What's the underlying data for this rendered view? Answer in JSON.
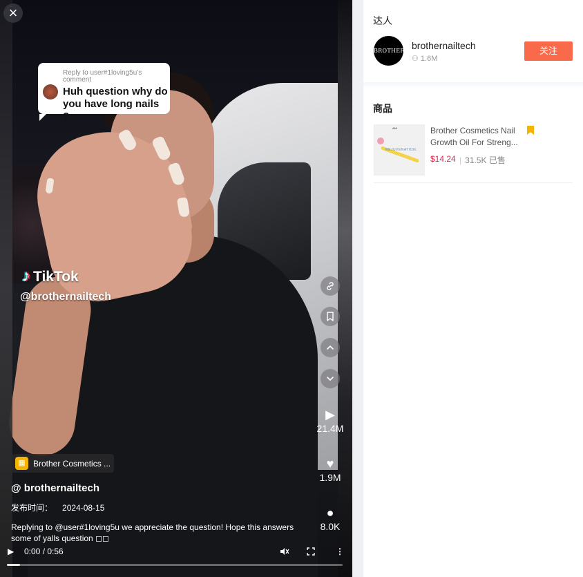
{
  "video": {
    "close_icon": "×",
    "comment_bubble": {
      "reply_to": "Reply to user#1loving5u's comment",
      "question": "Huh question why do you have long nails ?"
    },
    "watermark": {
      "brand": "TikTok",
      "handle": "@brothernailtech"
    },
    "side_buttons": [
      "link-icon",
      "bookmark-icon",
      "chevron-up-icon",
      "chevron-down-icon"
    ],
    "stats": {
      "plays": "21.4M",
      "likes": "1.9M",
      "comments": "8.0K"
    },
    "product_tag": "Brother Cosmetics ...",
    "author": "@ brothernailtech",
    "publish_label": "发布时间：",
    "publish_date": "2024-08-15",
    "description": "Replying to @user#1loving5u we appreciate the question! Hope this answers some of yalls question ◻◻",
    "time": "0:00 / 0:56",
    "progress": 0.04
  },
  "panel": {
    "creator_title": "达人",
    "creator": {
      "avatar_text": "BROTHER",
      "name": "brothernailtech",
      "fans": "1.6M",
      "follow_label": "关注"
    },
    "products_title": "商品",
    "product": {
      "title": "Brother Cosmetics Nail Growth Oil For Streng...",
      "price": "$14.24",
      "sold": "31.5K 已售",
      "image_text_top": "AMI",
      "image_text": "REJUVENATION."
    }
  },
  "colors": {
    "accent": "#f96a4b",
    "price": "#e0264a",
    "bookmark": "#f5b400"
  }
}
